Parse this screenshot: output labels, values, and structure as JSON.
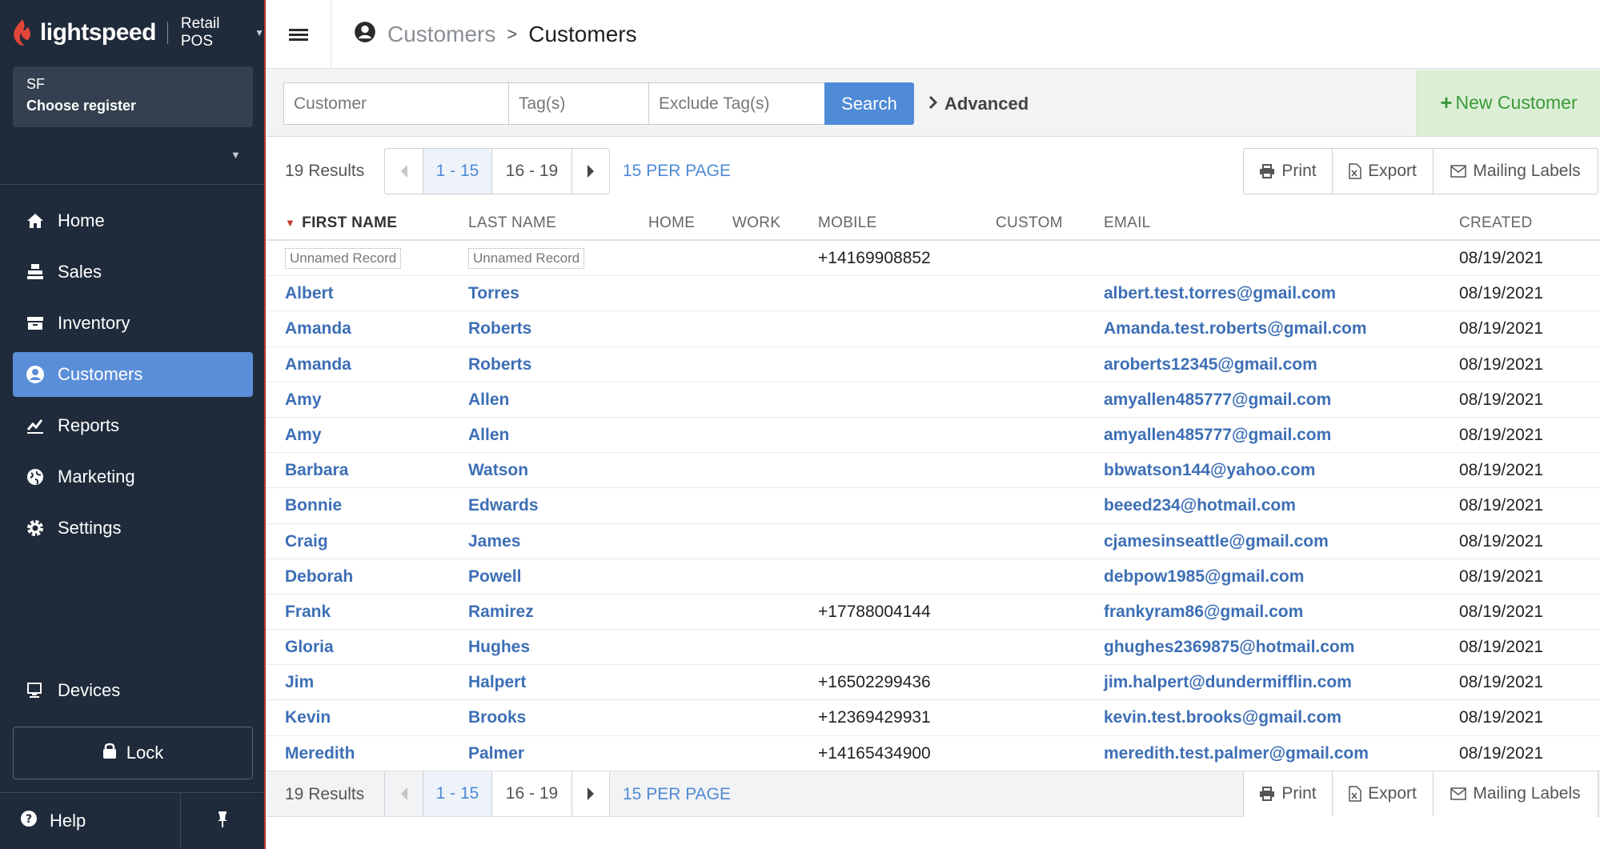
{
  "brand": {
    "logo_text": "lightspeed",
    "product": "Retail POS"
  },
  "register": {
    "store": "SF",
    "choose_label": "Choose register"
  },
  "nav": {
    "items": [
      {
        "label": "Home",
        "icon": "home-icon"
      },
      {
        "label": "Sales",
        "icon": "register-icon"
      },
      {
        "label": "Inventory",
        "icon": "inventory-icon"
      },
      {
        "label": "Customers",
        "icon": "customer-icon",
        "active": true
      },
      {
        "label": "Reports",
        "icon": "reports-icon"
      },
      {
        "label": "Marketing",
        "icon": "globe-icon"
      },
      {
        "label": "Settings",
        "icon": "gear-icon"
      }
    ],
    "devices_label": "Devices",
    "lock_label": "Lock",
    "help_label": "Help"
  },
  "header": {
    "breadcrumb_parent": "Customers",
    "breadcrumb_current": "Customers"
  },
  "search": {
    "customer_placeholder": "Customer",
    "tags_placeholder": "Tag(s)",
    "exclude_tags_placeholder": "Exclude Tag(s)",
    "search_label": "Search",
    "advanced_label": "Advanced",
    "new_customer_label": "New Customer"
  },
  "pagination": {
    "results": "19 Results",
    "page1": "1 - 15",
    "page2": "16 - 19",
    "per_page": "15 PER PAGE"
  },
  "actions": {
    "print": "Print",
    "export": "Export",
    "mailing_labels": "Mailing Labels"
  },
  "table": {
    "columns": [
      "FIRST NAME",
      "LAST NAME",
      "HOME",
      "WORK",
      "MOBILE",
      "CUSTOM",
      "EMAIL",
      "CREATED"
    ],
    "rows": [
      {
        "first": "Unnamed Record",
        "last": "Unnamed Record",
        "mobile": "+14169908852",
        "email": "",
        "created": "08/19/2021",
        "unnamed": true
      },
      {
        "first": "Albert",
        "last": "Torres",
        "mobile": "",
        "email": "albert.test.torres@gmail.com",
        "created": "08/19/2021"
      },
      {
        "first": "Amanda",
        "last": "Roberts",
        "mobile": "",
        "email": "Amanda.test.roberts@gmail.com",
        "created": "08/19/2021"
      },
      {
        "first": "Amanda",
        "last": "Roberts",
        "mobile": "",
        "email": "aroberts12345@gmail.com",
        "created": "08/19/2021"
      },
      {
        "first": "Amy",
        "last": "Allen",
        "mobile": "",
        "email": "amyallen485777@gmail.com",
        "created": "08/19/2021"
      },
      {
        "first": "Amy",
        "last": "Allen",
        "mobile": "",
        "email": "amyallen485777@gmail.com",
        "created": "08/19/2021"
      },
      {
        "first": "Barbara",
        "last": "Watson",
        "mobile": "",
        "email": "bbwatson144@yahoo.com",
        "created": "08/19/2021"
      },
      {
        "first": "Bonnie",
        "last": "Edwards",
        "mobile": "",
        "email": "beeed234@hotmail.com",
        "created": "08/19/2021"
      },
      {
        "first": "Craig",
        "last": "James",
        "mobile": "",
        "email": "cjamesinseattle@gmail.com",
        "created": "08/19/2021"
      },
      {
        "first": "Deborah",
        "last": "Powell",
        "mobile": "",
        "email": "debpow1985@gmail.com",
        "created": "08/19/2021"
      },
      {
        "first": "Frank",
        "last": "Ramirez",
        "mobile": "+17788004144",
        "email": "frankyram86@gmail.com",
        "created": "08/19/2021"
      },
      {
        "first": "Gloria",
        "last": "Hughes",
        "mobile": "",
        "email": "ghughes2369875@hotmail.com",
        "created": "08/19/2021"
      },
      {
        "first": "Jim",
        "last": "Halpert",
        "mobile": "+16502299436",
        "email": "jim.halpert@dundermifflin.com",
        "created": "08/19/2021"
      },
      {
        "first": "Kevin",
        "last": "Brooks",
        "mobile": "+12369429931",
        "email": "kevin.test.brooks@gmail.com",
        "created": "08/19/2021"
      },
      {
        "first": "Meredith",
        "last": "Palmer",
        "mobile": "+14165434900",
        "email": "meredith.test.palmer@gmail.com",
        "created": "08/19/2021"
      }
    ]
  },
  "colors": {
    "accent": "#4f8bd6",
    "sidebar": "#1f2a3a",
    "link": "#3d6fb6",
    "new_customer": "#3a9a3a"
  }
}
